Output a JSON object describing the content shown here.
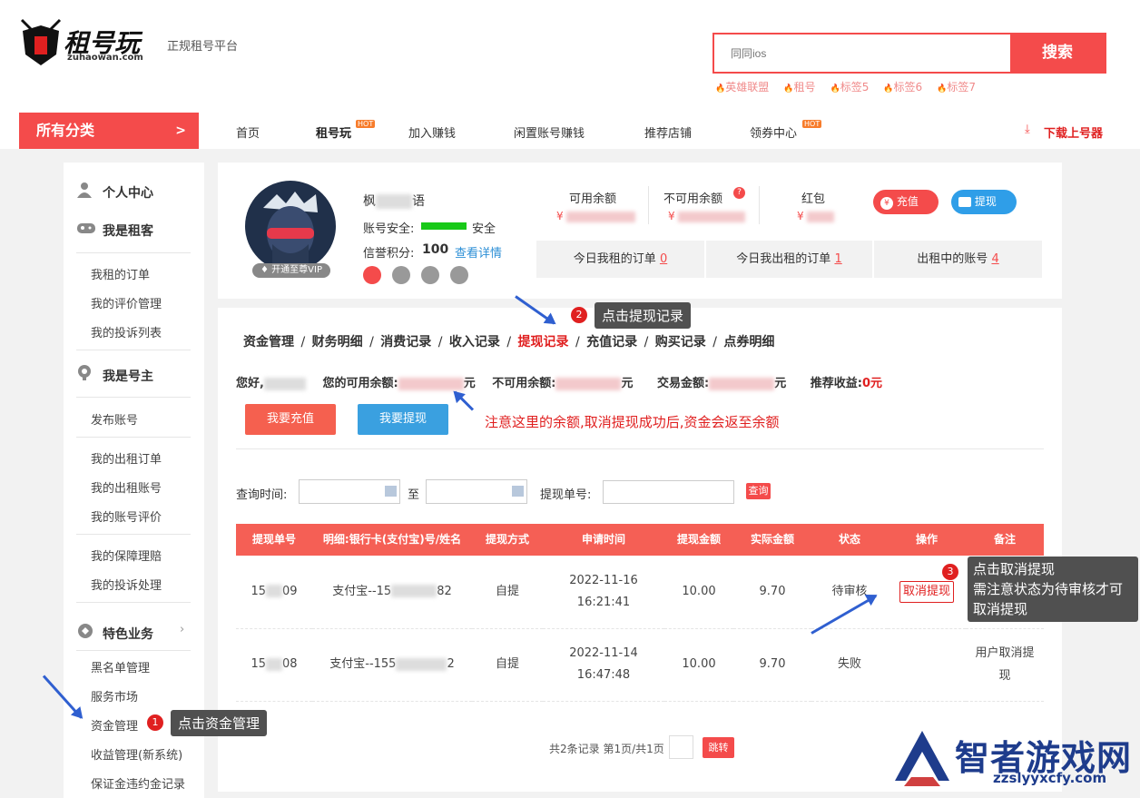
{
  "header": {
    "logo_cn": "租号玩",
    "logo_en": "zuhaowan.com",
    "slogan": "正规租号平台",
    "search_placeholder": "同同ios",
    "search_btn": "搜索",
    "hot_tags": [
      "英雄联盟",
      "租号",
      "标签5",
      "标签6",
      "标签7"
    ]
  },
  "nav": {
    "all_categories": "所有分类",
    "items": [
      "首页",
      "租号玩",
      "加入赚钱",
      "闲置账号赚钱",
      "推荐店铺",
      "领券中心"
    ],
    "hot": "HOT",
    "download": "下载上号器"
  },
  "sidebar": {
    "personal_center": "个人中心",
    "renter": "我是租客",
    "renter_items": [
      "我租的订单",
      "我的评价管理",
      "我的投诉列表"
    ],
    "owner": "我是号主",
    "owner_items1": [
      "发布账号"
    ],
    "owner_items2": [
      "我的出租订单",
      "我的出租账号",
      "我的账号评价"
    ],
    "owner_items3": [
      "我的保障理赔",
      "我的投诉处理"
    ],
    "special": "特色业务",
    "special_items": [
      "黑名单管理",
      "服务市场",
      "资金管理",
      "收益管理(新系统)",
      "保证金违约金记录"
    ]
  },
  "profile": {
    "name_a": "枫",
    "name_b": "语",
    "security_label": "账号安全:",
    "security_value": "安全",
    "credit_label": "信誉积分:",
    "credit_value": "100",
    "credit_link": "查看详情",
    "vip": "开通至尊VIP",
    "available_label": "可用余额",
    "unavailable_label": "不可用余额",
    "redpacket_label": "红包",
    "yen": "¥",
    "recharge_btn": "充值",
    "withdraw_btn": "提现",
    "stats": [
      {
        "label": "今日我租的订单",
        "value": "0"
      },
      {
        "label": "今日我出租的订单",
        "value": "1"
      },
      {
        "label": "出租中的账号",
        "value": "4"
      }
    ]
  },
  "fund": {
    "tabs": [
      "资金管理",
      "财务明细",
      "消费记录",
      "收入记录",
      "提现记录",
      "充值记录",
      "购买记录",
      "点券明细"
    ],
    "hello": "您好,",
    "available": "您的可用余额:",
    "unavailable": "不可用余额:",
    "trade": "交易金额:",
    "recommend": "推荐收益:",
    "recommend_value": "0元",
    "yuan": "元",
    "recharge_btn": "我要充值",
    "withdraw_btn": "我要提现",
    "query_time": "查询时间:",
    "to": "至",
    "withdraw_no": "提现单号:",
    "query_btn": "查询"
  },
  "table": {
    "headers": [
      "提现单号",
      "明细:银行卡(支付宝)号/姓名",
      "提现方式",
      "申请时间",
      "提现金额",
      "实际金额",
      "状态",
      "操作",
      "备注"
    ],
    "rows": [
      {
        "no_a": "15",
        "no_b": "09",
        "detail_a": "支付宝--15",
        "detail_b": "82",
        "method": "自提",
        "date": "2022-11-16",
        "time": "16:21:41",
        "amount": "10.00",
        "actual": "9.70",
        "status": "待审核",
        "action": "取消提现",
        "note": ""
      },
      {
        "no_a": "15",
        "no_b": "08",
        "detail_a": "支付宝--155",
        "detail_b": "2",
        "method": "自提",
        "date": "2022-11-14",
        "time": "16:47:48",
        "amount": "10.00",
        "actual": "9.70",
        "status": "失败",
        "action": "",
        "note": "用户取消提现"
      }
    ]
  },
  "pagination": {
    "text": "共2条记录 第1页/共1页",
    "jump": "跳转"
  },
  "annotations": {
    "step1": {
      "num": "1",
      "text": "点击资金管理"
    },
    "step2": {
      "num": "2",
      "text": "点击提现记录"
    },
    "step3": {
      "num": "3",
      "line1": "点击取消提现",
      "line2": "需注意状态为待审核才可",
      "line3": "取消提现"
    },
    "note": "注意这里的余额,取消提现成功后,资金会返至余额"
  },
  "watermark": {
    "cn": "智者游戏网",
    "en": "zzslyyxcfy.com"
  }
}
